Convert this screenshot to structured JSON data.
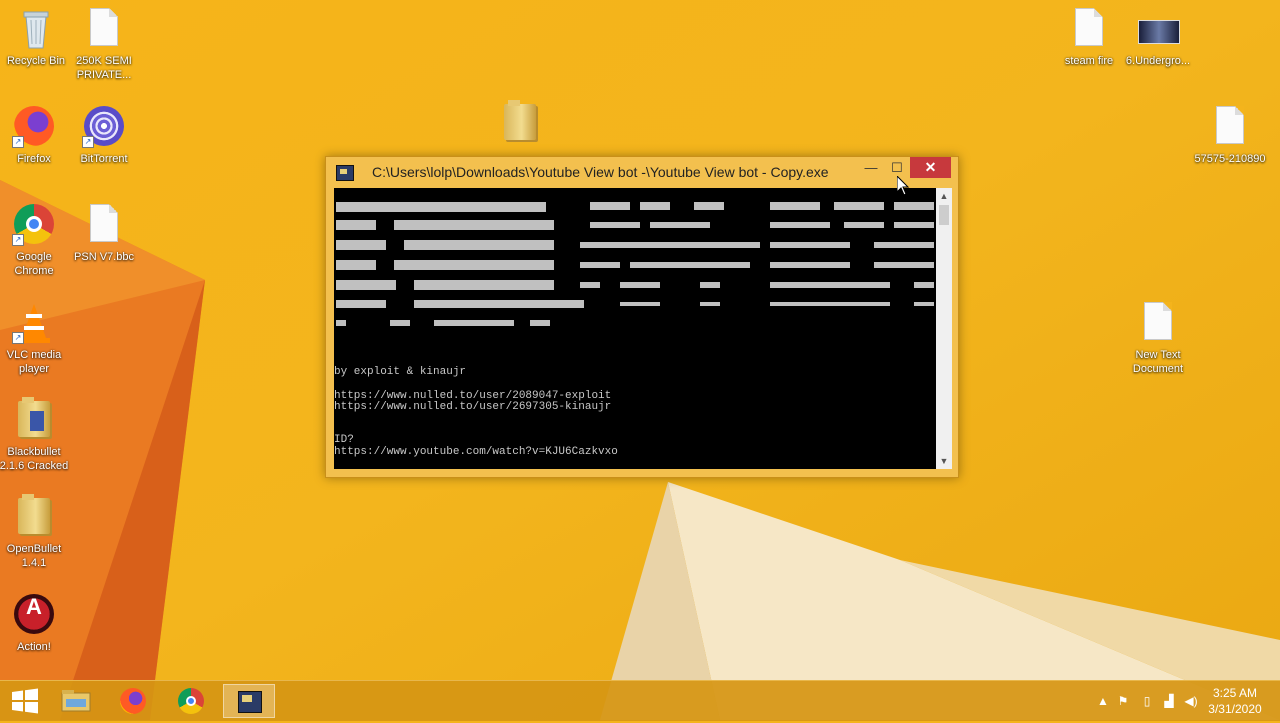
{
  "desktop": {
    "icons_left": [
      {
        "label": "Recycle Bin",
        "icon": "recycle-bin-icon"
      },
      {
        "label": "250K SEMI PRIVATE...",
        "icon": "text-file-icon"
      },
      {
        "label": "Firefox",
        "icon": "firefox-icon"
      },
      {
        "label": "BitTorrent",
        "icon": "bittorrent-icon"
      },
      {
        "label": "Google Chrome",
        "icon": "chrome-icon"
      },
      {
        "label": "PSN V7.bbc",
        "icon": "text-file-icon"
      },
      {
        "label": "VLC media player",
        "icon": "vlc-icon"
      },
      {
        "label": "Blackbullet 2.1.6 Cracked",
        "icon": "folder-icon"
      },
      {
        "label": "OpenBullet 1.4.1",
        "icon": "folder-icon"
      },
      {
        "label": "Action!",
        "icon": "action-icon"
      }
    ],
    "icons_right": [
      {
        "label": "steam fire",
        "icon": "text-file-icon"
      },
      {
        "label": "6.Undergro...",
        "icon": "image-file-icon"
      },
      {
        "label": "57575-210890",
        "icon": "text-file-icon"
      },
      {
        "label": "New Text Document",
        "icon": "text-file-icon"
      }
    ]
  },
  "window": {
    "title": "C:\\Users\\lolp\\Downloads\\Youtube View bot -\\Youtube View bot - Copy.exe",
    "minimize": "—",
    "maximize": "☐",
    "close": "✕",
    "console": {
      "credits": "by exploit & kinaujr",
      "link1": "https://www.nulled.to/user/2089047-exploit",
      "link2": "https://www.nulled.to/user/2697305-kinaujr",
      "prompt": "ID?",
      "input": "https://www.youtube.com/watch?v=KJU6Cazkvxo"
    }
  },
  "taskbar": {
    "items": [
      {
        "name": "start-button",
        "icon": "windows-icon"
      },
      {
        "name": "file-explorer",
        "icon": "file-explorer-icon"
      },
      {
        "name": "firefox",
        "icon": "firefox-icon"
      },
      {
        "name": "chrome",
        "icon": "chrome-icon"
      },
      {
        "name": "console-app",
        "icon": "console-icon",
        "active": true
      }
    ],
    "clock": {
      "time": "3:25 AM",
      "date": "3/31/2020"
    }
  },
  "colors": {
    "wallpaper_yellow": "#f4b41c",
    "wallpaper_orange": "#e8741f",
    "close_red": "#c7393d",
    "console_bg": "#000000"
  }
}
